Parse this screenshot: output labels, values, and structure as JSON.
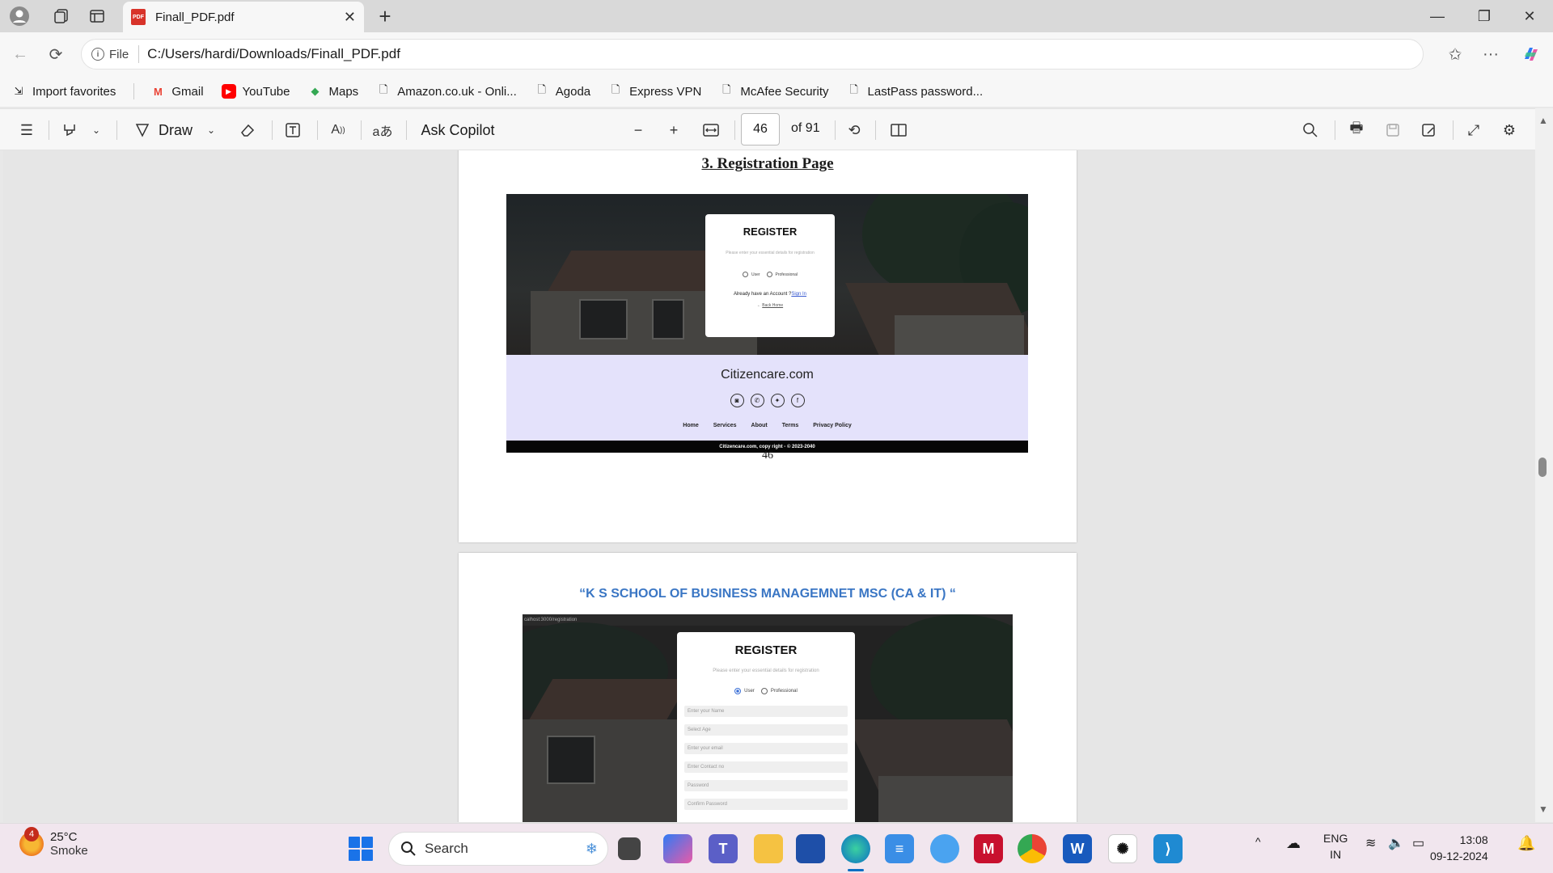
{
  "browser": {
    "tab_title": "Finall_PDF.pdf",
    "address_label": "File",
    "url": "C:/Users/hardi/Downloads/Finall_PDF.pdf"
  },
  "favorites": [
    {
      "label": "Import favorites",
      "icon": "import-icon"
    },
    {
      "label": "Gmail",
      "icon": "gmail-icon"
    },
    {
      "label": "YouTube",
      "icon": "youtube-icon"
    },
    {
      "label": "Maps",
      "icon": "maps-icon"
    },
    {
      "label": "Amazon.co.uk - Onli...",
      "icon": "page-icon"
    },
    {
      "label": "Agoda",
      "icon": "page-icon"
    },
    {
      "label": "Express VPN",
      "icon": "page-icon"
    },
    {
      "label": "McAfee Security",
      "icon": "page-icon"
    },
    {
      "label": "LastPass password...",
      "icon": "page-icon"
    }
  ],
  "pdf_toolbar": {
    "draw_label": "Draw",
    "ask_copilot_label": "Ask Copilot",
    "page_current": "46",
    "page_total": "of 91"
  },
  "page1": {
    "heading": "3. Registration Page",
    "page_number": "46",
    "register_title": "REGISTER",
    "register_sub": "Please enter your essential details for registration",
    "radio_user": "User",
    "radio_professional": "Professional",
    "already_text": "Already have an Account ?",
    "signin_link": "Sign In",
    "back_home": "Back Home",
    "brand": "Citizencare.com",
    "footer_links": [
      "Home",
      "Services",
      "About",
      "Terms",
      "Privacy Policy"
    ],
    "copyright": "Citizencare.com, copy right - © 2023-2040"
  },
  "page2": {
    "heading": "“K S SCHOOL OF BUSINESS MANAGEMNET MSC (CA & IT) “",
    "browser_url": "calhost:3000/registration",
    "register_title": "REGISTER",
    "register_sub": "Please enter your essential details for registration",
    "radio_user": "User",
    "radio_professional": "Professional",
    "fields": [
      "Enter your Name",
      "Select Age",
      "Enter your email",
      "Enter Contact no",
      "Password",
      "Confirm Password"
    ]
  },
  "taskbar": {
    "weather_badge": "4",
    "temperature": "25°C",
    "condition": "Smoke",
    "search_label": "Search",
    "lang_top": "ENG",
    "lang_bottom": "IN",
    "time": "13:08",
    "date": "09-12-2024"
  },
  "colors": {
    "accent_blue": "#3a76c4",
    "footer_lavender": "#e4e2fb",
    "taskbar": "#f1e6ee"
  }
}
